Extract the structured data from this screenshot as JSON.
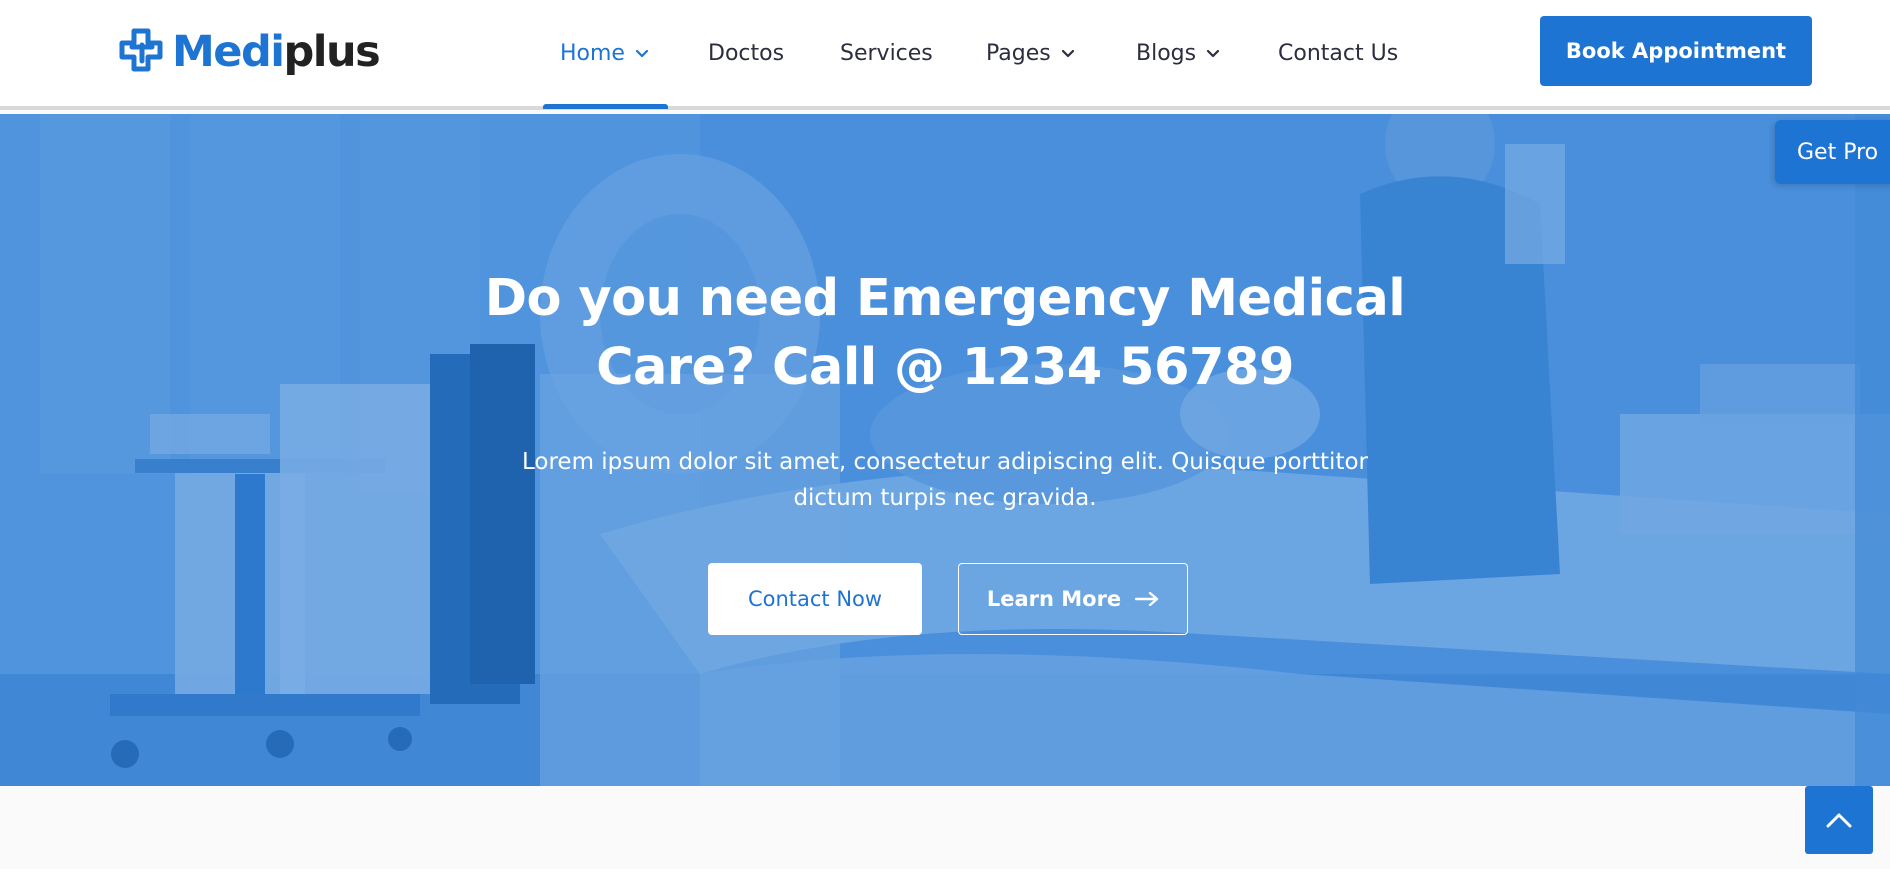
{
  "brand": {
    "name_part1": "Medi",
    "name_part2": "plus",
    "primary_color": "#1e74d2",
    "dark_color": "#222222"
  },
  "nav": {
    "items": [
      {
        "label": "Home",
        "has_dropdown": true,
        "active": true
      },
      {
        "label": "Doctos",
        "has_dropdown": false,
        "active": false
      },
      {
        "label": "Services",
        "has_dropdown": false,
        "active": false
      },
      {
        "label": "Pages",
        "has_dropdown": true,
        "active": false
      },
      {
        "label": "Blogs",
        "has_dropdown": true,
        "active": false
      },
      {
        "label": "Contact Us",
        "has_dropdown": false,
        "active": false
      }
    ],
    "cta_label": "Book Appointment"
  },
  "hero": {
    "title_line1": "Do you need Emergency Medical",
    "title_line2": "Care? Call @ 1234 56789",
    "subtitle_line1": "Lorem ipsum dolor sit amet, consectetur adipiscing elit. Quisque porttitor",
    "subtitle_line2": "dictum turpis nec gravida.",
    "primary_button": "Contact Now",
    "secondary_button": "Learn More",
    "secondary_icon": "arrow-right-icon",
    "overlay_color": "#1e74d2"
  },
  "floating": {
    "get_pro_label": "Get Pro",
    "scroll_top_icon": "chevron-up-icon"
  }
}
